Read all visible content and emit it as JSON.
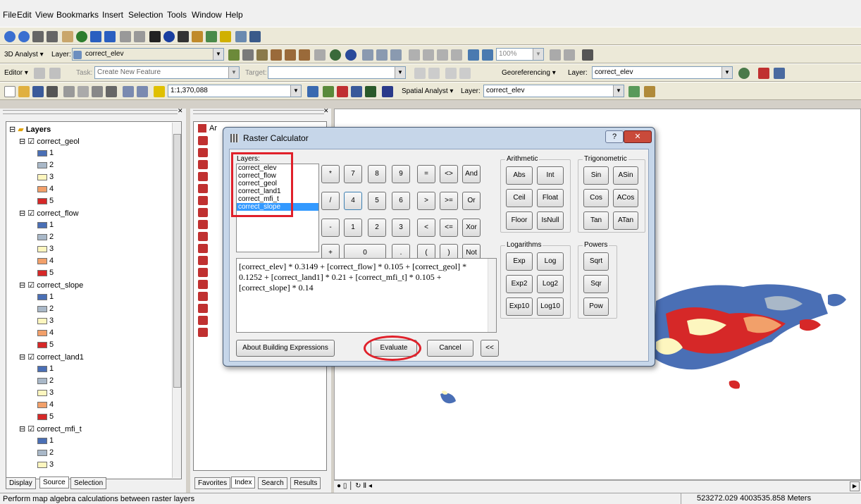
{
  "menu": {
    "items": [
      "File",
      "Edit",
      "View",
      "Bookmarks",
      "Insert",
      "Selection",
      "Tools",
      "Window",
      "Help"
    ]
  },
  "toolbar3": {
    "analyst": "3D Analyst ▾",
    "layer_label": "Layer:",
    "layer_value": "correct_elev",
    "zoom": "100%"
  },
  "toolbar4": {
    "editor": "Editor ▾",
    "task_label": "Task:",
    "task_value": "Create New Feature",
    "target_label": "Target:",
    "georef": "Georeferencing ▾",
    "layer_label": "Layer:",
    "layer_value": "correct_elev"
  },
  "toolbar5": {
    "scale": "1:1,370,088",
    "spatial": "Spatial Analyst ▾",
    "layer_label": "Layer:",
    "layer_value": "correct_elev"
  },
  "toc": {
    "root": "Layers",
    "layers": [
      {
        "name": "correct_geol",
        "classes": [
          "1",
          "2",
          "3",
          "4",
          "5"
        ]
      },
      {
        "name": "correct_flow",
        "classes": [
          "1",
          "2",
          "3",
          "4",
          "5"
        ]
      },
      {
        "name": "correct_slope",
        "classes": [
          "1",
          "2",
          "3",
          "4",
          "5"
        ]
      },
      {
        "name": "correct_land1",
        "classes": [
          "1",
          "2",
          "3",
          "4",
          "5"
        ]
      },
      {
        "name": "correct_mfi_t",
        "classes": [
          "1",
          "2",
          "3"
        ]
      }
    ],
    "tabs": [
      "Display",
      "Source",
      "Selection"
    ]
  },
  "catalog": {
    "title": "Ar",
    "tabs": [
      "Favorites",
      "Index",
      "Search",
      "Results"
    ]
  },
  "colors": {
    "c1": "#4a6fb5",
    "c2": "#a9b8c8",
    "c3": "#fdf6bf",
    "c4": "#f2a06a",
    "c5": "#d62828"
  },
  "calc": {
    "title": "Raster Calculator",
    "layers_label": "Layers:",
    "layers": [
      "correct_elev",
      "correct_flow",
      "correct_geol",
      "correct_land1",
      "correct_mfi_t",
      "correct_slope"
    ],
    "keypad": [
      "*",
      "7",
      "8",
      "9",
      "=",
      "<>",
      "And",
      "/",
      "4",
      "5",
      "6",
      ">",
      ">=",
      "Or",
      "-",
      "1",
      "2",
      "3",
      "<",
      "<=",
      "Xor",
      "+",
      "0",
      ".",
      "(",
      ")",
      "Not"
    ],
    "arithmetic_label": "Arithmetic",
    "arithmetic": [
      "Abs",
      "Int",
      "Ceil",
      "Float",
      "Floor",
      "IsNull"
    ],
    "trig_label": "Trigonometric",
    "trig": [
      "Sin",
      "ASin",
      "Cos",
      "ACos",
      "Tan",
      "ATan"
    ],
    "log_label": "Logarithms",
    "logs": [
      "Exp",
      "Log",
      "Exp2",
      "Log2",
      "Exp10",
      "Log10"
    ],
    "powers_label": "Powers",
    "powers": [
      "Sqrt",
      "Sqr",
      "Pow"
    ],
    "expression": "[correct_elev] * 0.3149 + [correct_flow] * 0.105 + [correct_geol] * 0.1252 + [correct_land1] * 0.21 + [correct_mfi_t] * 0.105 + [correct_slope] * 0.14",
    "about": "About Building Expressions",
    "evaluate": "Evaluate",
    "cancel": "Cancel",
    "collapse": "<<",
    "help": "?",
    "close": "✕"
  },
  "status": {
    "message": "Perform map algebra calculations between raster layers",
    "coords": "523272.029  4003535.858 Meters"
  }
}
